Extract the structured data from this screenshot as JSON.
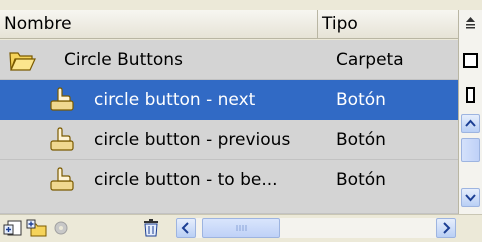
{
  "columns": {
    "name": "Nombre",
    "type": "Tipo"
  },
  "header_sort_icon": "sort-icon",
  "rows": [
    {
      "name": "Circle Buttons",
      "type": "Carpeta",
      "icon": "folder-icon",
      "selected": false
    },
    {
      "name": "circle button - next",
      "type": "Botón",
      "icon": "button-symbol-icon",
      "selected": true
    },
    {
      "name": "circle button - previous",
      "type": "Botón",
      "icon": "button-symbol-icon",
      "selected": false
    },
    {
      "name": "circle button - to be...",
      "type": "Botón",
      "icon": "button-symbol-icon",
      "selected": false
    }
  ],
  "toolbar": {
    "icons": [
      "new-symbol-icon",
      "new-folder-icon",
      "properties-icon",
      "delete-icon"
    ]
  },
  "colors": {
    "selection": "#316ac5",
    "row_bg": "#d4d4d4",
    "panel_bg": "#ece9d8"
  }
}
